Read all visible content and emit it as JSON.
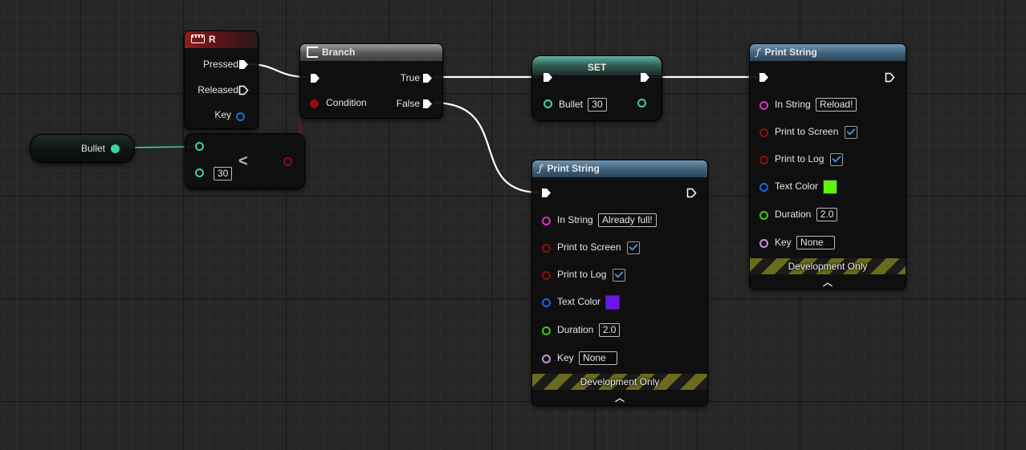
{
  "colors": {
    "exec": "#ffffff",
    "bool": "#8f0e0e",
    "int": "#41cfa5",
    "string": "#e62fb9",
    "linear_color": "#1566e6",
    "float": "#3fcb12",
    "name": "#c98de6",
    "key": "#1e6fd2",
    "text_color_green": "#5df110",
    "text_color_purple": "#6a14ee"
  },
  "nodes": {
    "key_event": {
      "title": "R",
      "icon": "keyboard-icon",
      "pins": {
        "pressed": "Pressed",
        "released": "Released",
        "key": "Key"
      }
    },
    "branch": {
      "title": "Branch",
      "icon": "branch-icon",
      "pins": {
        "condition": "Condition",
        "true": "True",
        "false": "False"
      }
    },
    "bullet_get": {
      "label": "Bullet"
    },
    "less_than": {
      "operator": "<",
      "b_value": "30"
    },
    "set_node": {
      "title": "SET",
      "var_label": "Bullet",
      "value": "30"
    },
    "print_false": {
      "title": "Print String",
      "icon": "function-icon",
      "in_string_label": "In String",
      "in_string_value": "Already full!",
      "print_screen_label": "Print to Screen",
      "print_log_label": "Print to Log",
      "text_color_label": "Text Color",
      "duration_label": "Duration",
      "duration_value": "2.0",
      "key_label": "Key",
      "key_value": "None",
      "dev_only": "Development Only"
    },
    "print_true": {
      "title": "Print String",
      "icon": "function-icon",
      "in_string_label": "In String",
      "in_string_value": "Reload!",
      "print_screen_label": "Print to Screen",
      "print_log_label": "Print to Log",
      "text_color_label": "Text Color",
      "duration_label": "Duration",
      "duration_value": "2.0",
      "key_label": "Key",
      "key_value": "None",
      "dev_only": "Development Only"
    }
  }
}
